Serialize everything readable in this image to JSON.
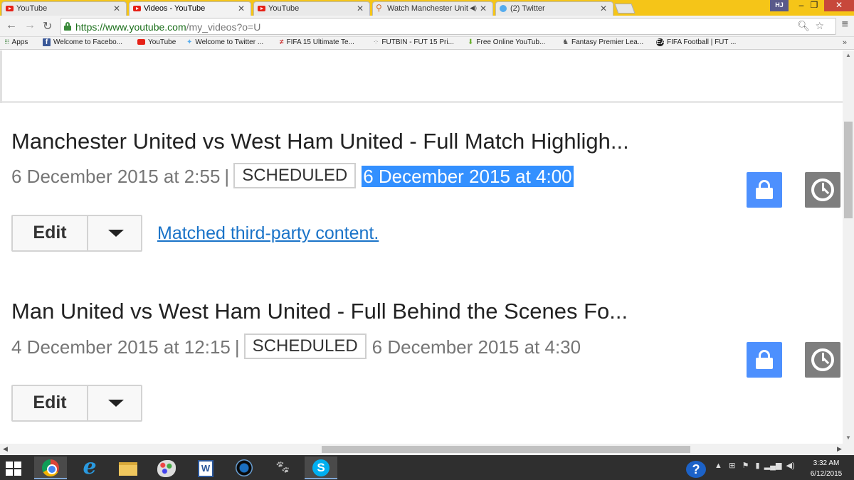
{
  "browser": {
    "tabs": [
      {
        "label": "YouTube",
        "icon": "youtube-icon"
      },
      {
        "label": "Videos - YouTube",
        "icon": "youtube-icon"
      },
      {
        "label": "YouTube",
        "icon": "youtube-icon"
      },
      {
        "label": "Watch Manchester Unit",
        "icon": "runner-icon"
      },
      {
        "label": "(2) Twitter",
        "icon": "twitter-icon"
      }
    ],
    "profile": "HJ",
    "url_host": "https://www.youtube.com",
    "url_path": "/my_videos?o=U"
  },
  "bookmarks": {
    "apps": "Apps",
    "items": [
      {
        "label": "Welcome to Facebo...",
        "icon": "facebook-icon"
      },
      {
        "label": "YouTube",
        "icon": "youtube-icon"
      },
      {
        "label": "Welcome to Twitter ...",
        "icon": "twitter-icon"
      },
      {
        "label": "FIFA 15 Ultimate Te...",
        "icon": "fifa-icon"
      },
      {
        "label": "FUTBIN - FUT 15 Pri...",
        "icon": "futbin-icon"
      },
      {
        "label": "Free Online YouTub...",
        "icon": "arrow-icon"
      },
      {
        "label": "Fantasy Premier Lea...",
        "icon": "premier-league-icon"
      },
      {
        "label": "FIFA Football | FUT ...",
        "icon": "ea-icon"
      }
    ],
    "more": "»"
  },
  "videos": [
    {
      "title": "Manchester United vs West Ham United - Full Match Highligh...",
      "uploaded": "6 December 2015 at 2:55",
      "separator": "|",
      "status": "SCHEDULED",
      "scheduled_for": "6 December 2015 at 4:00",
      "edit_label": "Edit",
      "notice": "Matched third-party content."
    },
    {
      "title": "Man United vs West Ham United - Full Behind the Scenes Fo...",
      "uploaded": "4 December 2015 at 12:15",
      "separator": "|",
      "status": "SCHEDULED",
      "scheduled_for": "6 December 2015 at 4:30",
      "edit_label": "Edit"
    }
  ],
  "taskbar": {
    "time": "3:32 AM",
    "date": "6/12/2015"
  },
  "colors": {
    "selection": "#3390ff",
    "link": "#1a73c8",
    "privacy_button": "#4d90fe",
    "schedule_button": "#7e7e7e",
    "tabstrip": "#f5c518"
  }
}
